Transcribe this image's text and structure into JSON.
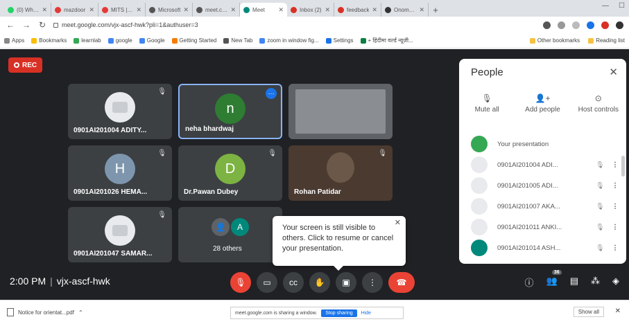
{
  "browser": {
    "tabs": [
      {
        "label": "(0) WhatsApp",
        "color": "#25d366"
      },
      {
        "label": "mazdoor",
        "color": "#e53935"
      },
      {
        "label": "MITS | Dash",
        "color": "#e53935"
      },
      {
        "label": "Microsoft",
        "color": "#555555"
      },
      {
        "label": "meet.com",
        "color": "#555555"
      },
      {
        "label": "Meet",
        "color": "#00897b",
        "active": true
      },
      {
        "label": "Inbox (2)",
        "color": "#d93025"
      },
      {
        "label": "feedback",
        "color": "#d93025"
      },
      {
        "label": "Onomatop",
        "color": "#333333"
      }
    ],
    "url": "meet.google.com/vjx-ascf-hwk?pli=1&authuser=3",
    "bookmarks": [
      "Apps",
      "Bookmarks",
      "learnlab",
      "google",
      "Google",
      "Getting Started",
      "New Tab",
      "zoom in window fig...",
      "Settings",
      "+ हिंदीमा वर्ल्ड न्यूज़ी..."
    ],
    "bookmarks_right": [
      "Other bookmarks",
      "Reading list"
    ]
  },
  "meet": {
    "rec_label": "REC",
    "tiles": [
      {
        "name": "0901AI201004 ADITY...",
        "avatar_letter": "",
        "avatar_color": "#e8eaed",
        "type": "img"
      },
      {
        "name": "neha bhardwaj",
        "avatar_letter": "n",
        "avatar_color": "#2e7d32",
        "type": "letter",
        "active": true
      },
      {
        "name": "",
        "avatar_letter": "",
        "avatar_color": "",
        "type": "screen"
      },
      {
        "name": "0901AI201026 HEMA...",
        "avatar_letter": "H",
        "avatar_color": "#7e96ad",
        "type": "letter"
      },
      {
        "name": "Dr.Pawan Dubey",
        "avatar_letter": "D",
        "avatar_color": "#7cb342",
        "type": "letter"
      },
      {
        "name": "Rohan Patidar",
        "avatar_letter": "",
        "avatar_color": "",
        "type": "video"
      },
      {
        "name": "0901AI201047 SAMAR...",
        "avatar_letter": "",
        "avatar_color": "#e8eaed",
        "type": "img"
      },
      {
        "name": "28 others",
        "avatar_letter": "A",
        "avatar_color": "#00897b",
        "type": "others"
      }
    ],
    "time": "2:00 PM",
    "meeting_code": "vjx-ascf-hwk",
    "participant_count": "36",
    "tooltip": "Your screen is still visible to others. Click to resume or cancel your presentation."
  },
  "people": {
    "title": "People",
    "actions": [
      "Mute all",
      "Add people",
      "Host controls"
    ],
    "list": [
      {
        "name": "Your presentation",
        "color": "#34a853"
      },
      {
        "name": "0901AI201004 ADI...",
        "color": "#e8eaed"
      },
      {
        "name": "0901AI201005 ADI...",
        "color": "#e8eaed"
      },
      {
        "name": "0901AI201007 AKA...",
        "color": "#e8eaed"
      },
      {
        "name": "0901AI201011 ANKI...",
        "color": "#e8eaed"
      },
      {
        "name": "0901AI201014 ASH...",
        "color": "#00897b"
      }
    ]
  },
  "downloads": {
    "file": "Notice for orientat...pdf",
    "sharing_text": "meet.google.com is sharing a window.",
    "stop_label": "Stop sharing",
    "hide_label": "Hide",
    "show_all_label": "Show all"
  }
}
